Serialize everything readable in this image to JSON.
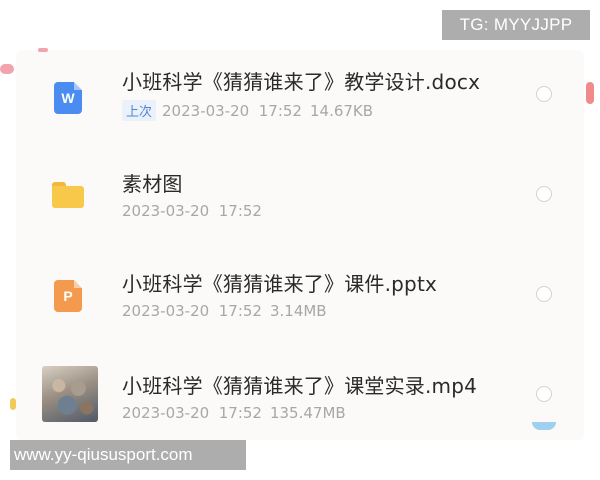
{
  "watermark": {
    "tg": "TG: MYYJJPP",
    "url": "www.yy-qiususport.com"
  },
  "files": [
    {
      "name": "小班科学《猜猜谁来了》教学设计.docx",
      "badge": "上次",
      "date": "2023-03-20",
      "time": "17:52",
      "size": "14.67KB",
      "icon": "word-doc-icon",
      "icon_letter": "W",
      "icon_color": "#4a8cf0"
    },
    {
      "name": "素材图",
      "date": "2023-03-20",
      "time": "17:52",
      "icon": "folder-icon",
      "icon_color": "#f8c84a"
    },
    {
      "name": "小班科学《猜猜谁来了》课件.pptx",
      "date": "2023-03-20",
      "time": "17:52",
      "size": "3.14MB",
      "icon": "ppt-doc-icon",
      "icon_letter": "P",
      "icon_color": "#f39a4f"
    },
    {
      "name": "小班科学《猜猜谁来了》课堂实录.mp4",
      "date": "2023-03-20",
      "time": "17:52",
      "size": "135.47MB",
      "icon": "video-thumbnail"
    }
  ]
}
